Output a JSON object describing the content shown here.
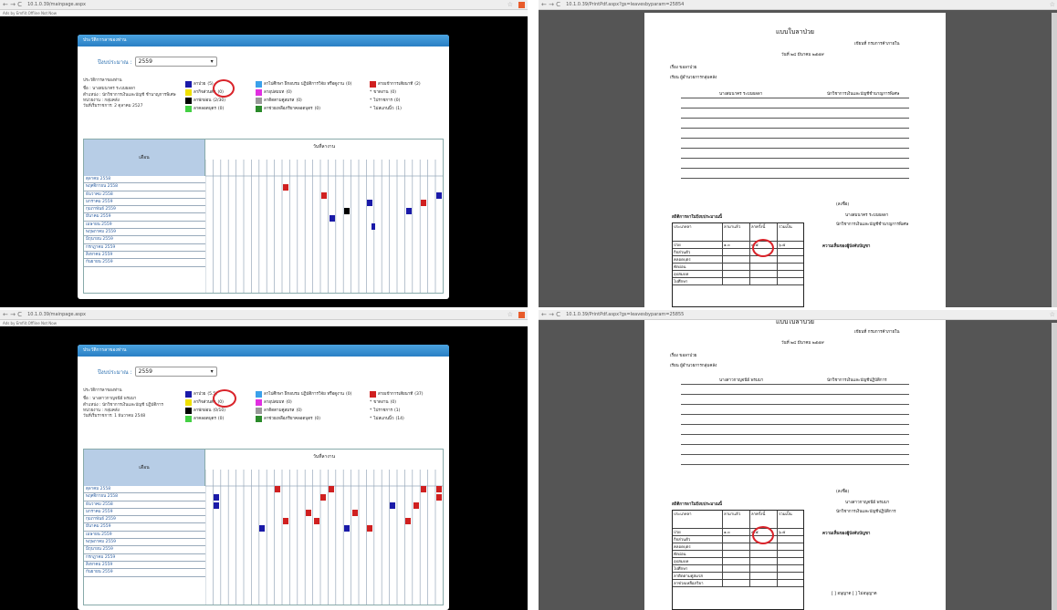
{
  "colors": {
    "accent": "#2a7fc4",
    "circle": "#d9232a",
    "chrome": "#eeeeee"
  },
  "icons": {
    "nav": "back-forward-reload-icons",
    "star": "bookmark-star-icon",
    "menu": "browser-menu-icon"
  },
  "q1": {
    "url": "10.1.0.39/mainpage.aspx",
    "bookmark": "Ads by Emfiit.Offline Not Now",
    "panel_title": "ประวัติการลาของท่าน",
    "year_label": "ปีงบประมาณ :",
    "year": "2559",
    "info": [
      "ประวัติการลาของท่าน",
      "ชื่อ : นางสมนาคร ระบบผลลา",
      "ตำแหน่ง : นักวิชาการเงินและบัญชี ชำนาญการพิเศษ",
      "หน่วยงาน : กลุ่มคลัง",
      "วันที่เริ่มราชการ: 2 ตุลาคม 2527"
    ],
    "legend": [
      {
        "label": "ลาป่วย",
        "count": "(5)",
        "color": "#1a1aa8"
      },
      {
        "label": "ลากิจส่วนตัว",
        "count": "(0)",
        "color": "#f0e000"
      },
      {
        "label": "ลาพักผ่อน",
        "count": "(2/30)",
        "color": "#000000"
      },
      {
        "label": "ลาคลอดบุตร",
        "count": "(0)",
        "color": "#44d044"
      },
      {
        "label": "ลาไปศึกษา ฝึกอบรม ปฏิบัติการวิจัย หรือดูงาน",
        "count": "(0)",
        "color": "#3aa0ea"
      },
      {
        "label": "ลาอุปสมบท",
        "count": "(0)",
        "color": "#e030e0"
      },
      {
        "label": "ลาติดตามคู่สมรส",
        "count": "(0)",
        "color": "#999999"
      },
      {
        "label": "ลาช่วยเหลือภริยาคลอดบุตร",
        "count": "(0)",
        "color": "#2a8a2a"
      },
      {
        "label": "สายเข้าการเสียนาที",
        "count": "(2)",
        "color": "#d02020"
      },
      {
        "label": "ขาดงาน",
        "count": "(0)",
        "color": ""
      },
      {
        "label": "ไปราชการ",
        "count": "(0)",
        "color": ""
      },
      {
        "label": "ไม่สแกนนิ้ว",
        "count": "(1)",
        "color": ""
      }
    ],
    "grid_month": "เดือน",
    "grid_days": "วันที่ลางาน",
    "months": [
      "ตุลาคม 2558",
      "พฤศจิกายน 2558",
      "ธันวาคม 2558",
      "มกราคม 2559",
      "กุมภาพันธ์ 2559",
      "มีนาคม 2559",
      "เมษายน 2559",
      "พฤษภาคม 2559",
      "มิถุนายน 2559",
      "กรกฎาคม 2559",
      "สิงหาคม 2559",
      "กันยายน 2559"
    ]
  },
  "q2": {
    "url": "10.1.0.39/PrintPdf.aspx?gs=leavesbyparam=25854",
    "form_title": "แบบใบลาป่วย",
    "writer": "เขียนที่ กรมการค้าภายใน",
    "date": "วันที่ ๒๔ มีนาคม ๒๕๕๙",
    "subject": "เรื่อง ขอลาป่วย",
    "to": "เรียน ผู้อำนวยการกลุ่มคลัง",
    "name": "นางสมนาคร ระบบผลลา",
    "position": "นักวิชาการเงินและบัญชีชำนาญการพิเศษ",
    "table_title": "สถิติการลาในปีงบประมาณนี้",
    "cols": [
      "ประเภทลา",
      "ลามาแล้ว",
      "ลาครั้งนี้",
      "รวมเป็น"
    ],
    "sign": "(ลงชื่อ)",
    "comment": "ความเห็นของผู้บังคับบัญชา"
  },
  "q3": {
    "url": "10.1.0.39/mainpage.aspx",
    "bookmark": "Ads by Emfiit.Offline Not Now",
    "panel_title": "ประวัติการลาของท่าน",
    "year_label": "ปีงบประมาณ :",
    "year": "2559",
    "info": [
      "ประวัติการลาของท่าน",
      "ชื่อ : นางสาวกาญจนีย์ พรมมา",
      "ตำแหน่ง : นักวิชาการเงินและบัญชี ปฏิบัติการ",
      "หน่วยงาน : กลุ่มคลัง",
      "วันที่เริ่มราชการ: 1 ธันวาคม 2548"
    ],
    "legend": [
      {
        "label": "ลาป่วย",
        "count": "(5.5)",
        "color": "#1a1aa8"
      },
      {
        "label": "ลากิจส่วนตัว",
        "count": "(0)",
        "color": "#f0e000"
      },
      {
        "label": "ลาพักผ่อน",
        "count": "(0/10)",
        "color": "#000000"
      },
      {
        "label": "ลาคลอดบุตร",
        "count": "(0)",
        "color": "#44d044"
      },
      {
        "label": "ลาไปศึกษา ฝึกอบรม ปฏิบัติการวิจัย หรือดูงาน",
        "count": "(0)",
        "color": "#3aa0ea"
      },
      {
        "label": "ลาอุปสมบท",
        "count": "(0)",
        "color": "#e030e0"
      },
      {
        "label": "ลาติดตามคู่สมรส",
        "count": "(0)",
        "color": "#999999"
      },
      {
        "label": "ลาช่วยเหลือภริยาคลอดบุตร",
        "count": "(0)",
        "color": "#2a8a2a"
      },
      {
        "label": "สายเข้าการเสียนาที",
        "count": "(37)",
        "color": "#d02020"
      },
      {
        "label": "ขาดงาน",
        "count": "(0)",
        "color": ""
      },
      {
        "label": "ไปราชการ",
        "count": "(1)",
        "color": ""
      },
      {
        "label": "ไม่สแกนนิ้ว",
        "count": "(14)",
        "color": ""
      }
    ],
    "grid_month": "เดือน",
    "grid_days": "วันที่ลางาน",
    "months": [
      "ตุลาคม 2558",
      "พฤศจิกายน 2558",
      "ธันวาคม 2558",
      "มกราคม 2559",
      "กุมภาพันธ์ 2559",
      "มีนาคม 2559",
      "เมษายน 2559",
      "พฤษภาคม 2559",
      "มิถุนายน 2559",
      "กรกฎาคม 2559",
      "สิงหาคม 2559",
      "กันยายน 2559"
    ]
  },
  "q4": {
    "url": "10.1.0.39/PrintPdf.aspx?gs=leavesbyparam=25855",
    "form_title": "แบบใบลาป่วย",
    "writer": "เขียนที่ กรมการค้าภายใน",
    "date": "วันที่ ๒๔ มีนาคม ๒๕๕๙",
    "subject": "เรื่อง ขอลาป่วย",
    "to": "เรียน ผู้อำนวยการกลุ่มคลัง",
    "name": "นางสาวกาญจนีย์ พรมมา",
    "position": "นักวิชาการเงินและบัญชีปฏิบัติการ",
    "table_title": "สถิติการลาในปีงบประมาณนี้",
    "cols": [
      "ประเภทลา",
      "ลามาแล้ว",
      "ลาครั้งนี้",
      "รวมเป็น"
    ],
    "sign": "(ลงชื่อ)",
    "comment": "ความเห็นของผู้บังคับบัญชา",
    "approve": "[ ] อนุญาต   [ ] ไม่อนุญาต"
  }
}
